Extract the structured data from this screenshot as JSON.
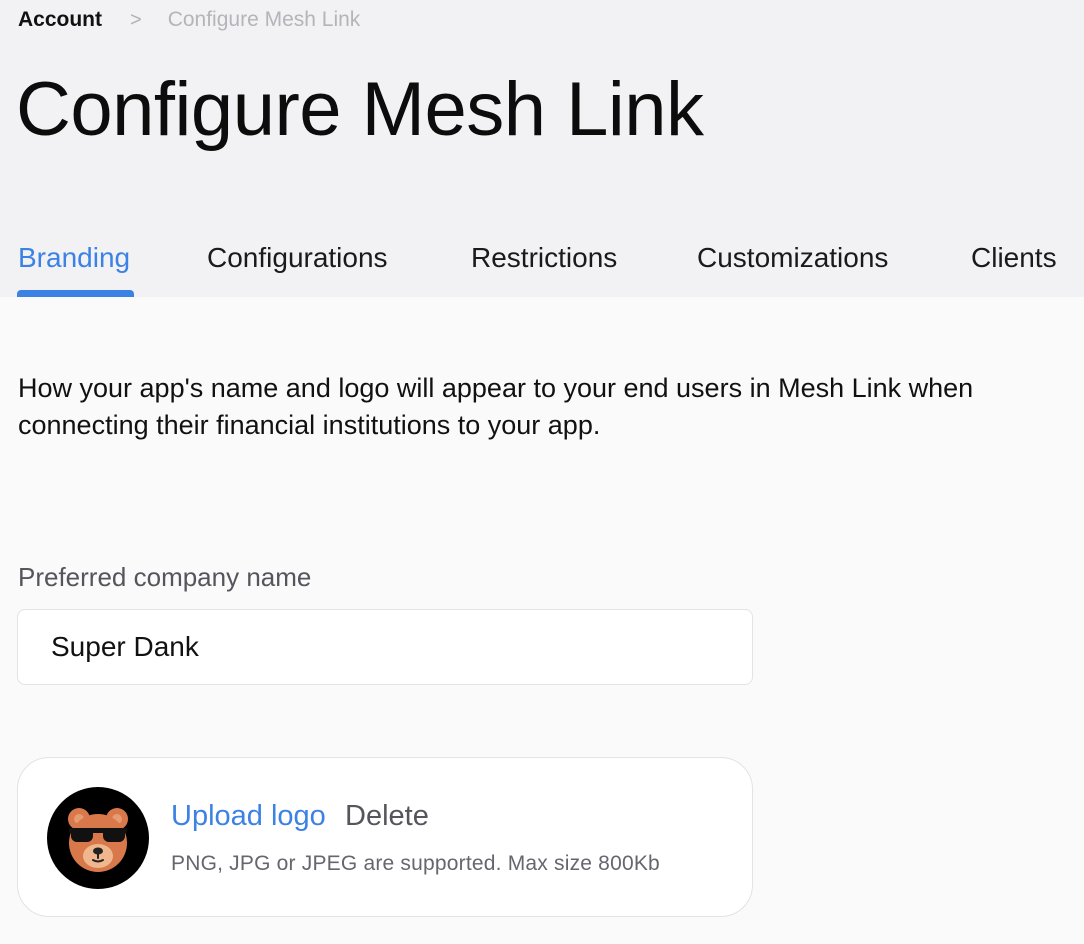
{
  "breadcrumb": {
    "root": "Account",
    "separator": ">",
    "current": "Configure Mesh Link"
  },
  "page": {
    "title": "Configure Mesh Link"
  },
  "tabs": [
    {
      "label": "Branding",
      "active": true
    },
    {
      "label": "Configurations",
      "active": false
    },
    {
      "label": "Restrictions",
      "active": false
    },
    {
      "label": "Customizations",
      "active": false
    },
    {
      "label": "Clients",
      "active": false
    }
  ],
  "branding": {
    "description": "How your app's name and logo will appear to your end users in Mesh Link when connecting their financial institutions to your app.",
    "company_name_label": "Preferred company name",
    "company_name_value": "Super Dank",
    "logo": {
      "icon": "bear-with-sunglasses-logo",
      "upload_label": "Upload logo",
      "delete_label": "Delete",
      "hint": "PNG, JPG or JPEG are supported. Max size 800Kb"
    }
  },
  "colors": {
    "accent": "#3c82e4",
    "header_bg": "#f2f2f4",
    "page_bg": "#fafafa"
  }
}
